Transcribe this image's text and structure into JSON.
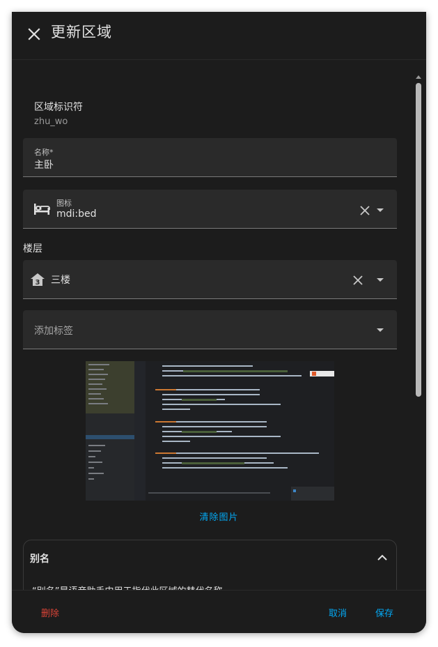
{
  "dialog": {
    "title": "更新区域",
    "close_icon": "close-icon"
  },
  "area_id": {
    "label": "区域标识符",
    "value": "zhu_wo"
  },
  "name_field": {
    "label": "名称*",
    "value": "主卧"
  },
  "icon_field": {
    "label": "图标",
    "value": "mdi:bed",
    "leading_icon": "bed-icon"
  },
  "floor": {
    "heading": "楼层",
    "value": "三楼",
    "leading_icon": "home-floor-3-icon"
  },
  "labels_field": {
    "placeholder": "添加标签"
  },
  "picture": {
    "clear_label": "清除图片"
  },
  "aliases": {
    "title": "别名",
    "description": "“别名”是语音助手中用于指代此区域的替代名称。"
  },
  "footer": {
    "delete_label": "删除",
    "cancel_label": "取消",
    "save_label": "保存"
  },
  "colors": {
    "dialog_bg": "#1c1c1c",
    "field_bg": "#2a2a2a",
    "accent": "#03a9f4",
    "danger": "#db4437",
    "text_primary": "#e1e1e1",
    "text_secondary": "#9a9a9a"
  }
}
